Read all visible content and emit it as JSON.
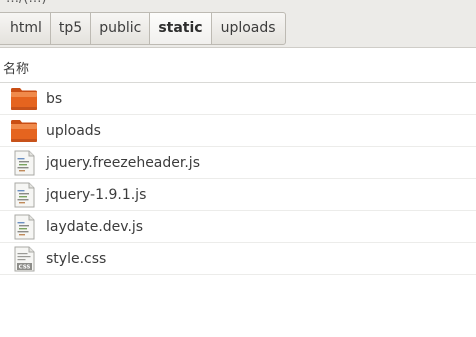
{
  "window": {
    "title_fragment": "…/(…)"
  },
  "breadcrumbs": [
    {
      "label": "html"
    },
    {
      "label": "tp5"
    },
    {
      "label": "public"
    },
    {
      "label": "static",
      "active": true
    },
    {
      "label": "uploads"
    }
  ],
  "list_header": {
    "name_column": "名称"
  },
  "files": [
    {
      "name": "bs",
      "icon": "folder-icon"
    },
    {
      "name": "uploads",
      "icon": "folder-icon"
    },
    {
      "name": "jquery.freezeheader.js",
      "icon": "javascript-file-icon"
    },
    {
      "name": "jquery-1.9.1.js",
      "icon": "javascript-file-icon"
    },
    {
      "name": "laydate.dev.js",
      "icon": "javascript-file-icon"
    },
    {
      "name": "style.css",
      "icon": "css-file-icon"
    }
  ],
  "icon_badges": {
    "css": "CSS"
  },
  "colors": {
    "folder": "#e5641f",
    "folder_tab": "#c94e14",
    "toolbar_bg": "#ecebe8",
    "active_crumb_bg": "#fbfbfa"
  }
}
